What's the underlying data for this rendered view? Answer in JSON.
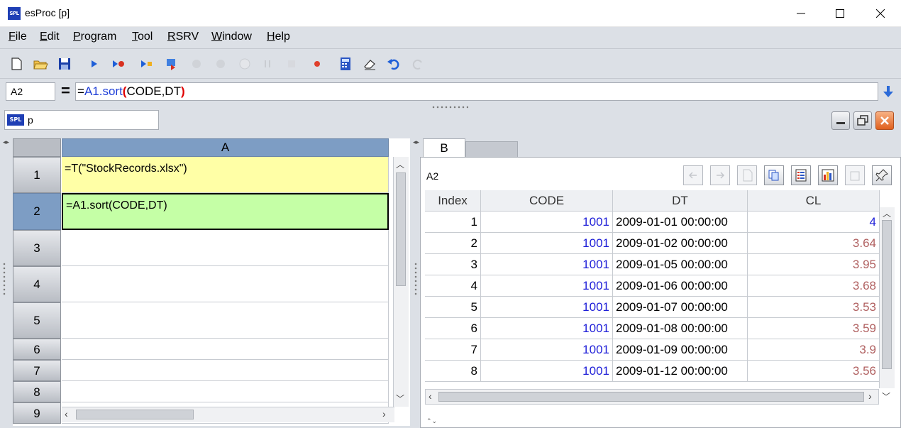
{
  "window": {
    "title": "esProc  [p]",
    "app_logo": "SPL"
  },
  "menu": [
    {
      "label": "File",
      "underline": "F",
      "rest": "ile"
    },
    {
      "label": "Edit",
      "underline": "E",
      "rest": "dit"
    },
    {
      "label": "Program",
      "underline": "P",
      "rest": "rogram"
    },
    {
      "label": "Tool",
      "underline": "T",
      "rest": "ool"
    },
    {
      "label": "RSRV",
      "underline": "R",
      "rest": "SRV"
    },
    {
      "label": "Window",
      "underline": "W",
      "rest": "indow"
    },
    {
      "label": "Help",
      "underline": "H",
      "rest": "elp"
    }
  ],
  "toolbar_icons": [
    "new-file-icon",
    "open-folder-icon",
    "save-icon",
    "run-icon",
    "debug-run-icon",
    "step-icon",
    "step-into-icon",
    "step-over-icon",
    "step-out-icon",
    "breakpoint-toggle-icon",
    "pause-icon",
    "stop-icon",
    "breakpoint-icon",
    "calculator-icon",
    "clear-icon",
    "undo-icon",
    "redo-icon"
  ],
  "formula_bar": {
    "cell_ref": "A2",
    "eq": "=",
    "formula": {
      "eq": "=",
      "ref": "A1",
      "dot_fn": ".sort",
      "open": "(",
      "args": "CODE,DT",
      "close": ")"
    }
  },
  "sheet": {
    "tab_name": "p",
    "logo": "SPL"
  },
  "grid": {
    "column_header": "A",
    "rows": [
      {
        "num": "1",
        "content": "=T(\"StockRecords.xlsx\")"
      },
      {
        "num": "2",
        "content": "=A1.sort(CODE,DT)"
      },
      {
        "num": "3",
        "content": ""
      },
      {
        "num": "4",
        "content": ""
      },
      {
        "num": "5",
        "content": ""
      },
      {
        "num": "6",
        "content": ""
      },
      {
        "num": "7",
        "content": ""
      },
      {
        "num": "8",
        "content": ""
      },
      {
        "num": "9",
        "content": ""
      }
    ]
  },
  "result": {
    "tab_label": "B",
    "cell": "A2",
    "columns": [
      "Index",
      "CODE",
      "DT",
      "CL"
    ],
    "rows": [
      {
        "index": "1",
        "code": "1001",
        "dt": "2009-01-01 00:00:00",
        "cl": "4"
      },
      {
        "index": "2",
        "code": "1001",
        "dt": "2009-01-02 00:00:00",
        "cl": "3.64"
      },
      {
        "index": "3",
        "code": "1001",
        "dt": "2009-01-05 00:00:00",
        "cl": "3.95"
      },
      {
        "index": "4",
        "code": "1001",
        "dt": "2009-01-06 00:00:00",
        "cl": "3.68"
      },
      {
        "index": "5",
        "code": "1001",
        "dt": "2009-01-07 00:00:00",
        "cl": "3.53"
      },
      {
        "index": "6",
        "code": "1001",
        "dt": "2009-01-08 00:00:00",
        "cl": "3.59"
      },
      {
        "index": "7",
        "code": "1001",
        "dt": "2009-01-09 00:00:00",
        "cl": "3.9"
      },
      {
        "index": "8",
        "code": "1001",
        "dt": "2009-01-12 00:00:00",
        "cl": "3.56"
      }
    ]
  },
  "colors": {
    "accent": "#7d9dc4",
    "cell1_bg": "#ffffa6",
    "cell2_bg": "#c5ffa6",
    "chrome_bg": "#dce0e6"
  }
}
